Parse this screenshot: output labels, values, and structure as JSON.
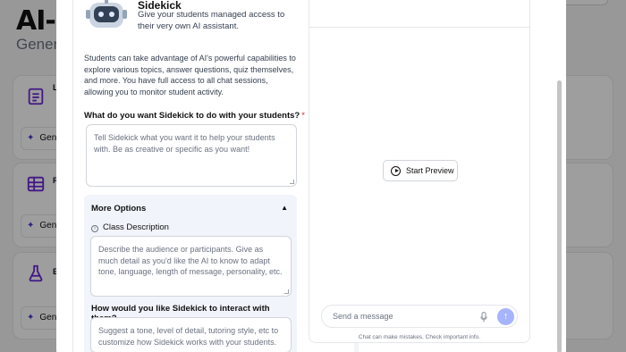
{
  "background": {
    "title": "AI-I",
    "subtitle": "Genera",
    "cards": [
      {
        "icon": "document-icon",
        "label": "L",
        "button": "Gene"
      },
      {
        "icon": "table-icon",
        "label": "R",
        "button": "Gene"
      },
      {
        "icon": "flask-icon",
        "label": "E",
        "button": "Gene"
      }
    ]
  },
  "sidekick": {
    "name": "Sidekick",
    "tagline": "Give your students managed access to their very own AI assistant.",
    "intro": "Students can take advantage of AI's powerful capabilities to explore various topics, answer questions, quiz themselves, and more. You have full access to all chat sessions, allowing you to monitor student activity.",
    "question_label": "What do you want Sidekick to do with your students?",
    "required_marker": "*",
    "question_placeholder": "Tell Sidekick what you want it to help your students with. Be as creative or specific as you want!",
    "more_options": {
      "title": "More Options",
      "class_description_label": "Class Description",
      "class_description_placeholder": "Describe the audience or participants. Give as much detail as you'd like the AI to know to adapt tone, language, length of message, personality, etc.",
      "interaction_label": "How would you like Sidekick to interact with them?",
      "interaction_placeholder": "Suggest a tone, level of detail, tutoring style, etc to customize how Sidekick works with your students."
    }
  },
  "preview": {
    "start_label": "Start Preview",
    "message_placeholder": "Send a message",
    "disclaimer": "Chat can make mistakes. Check important info."
  },
  "colors": {
    "accent": "#6d28d9",
    "send_button": "#a5b4fc",
    "required": "#dc2626",
    "options_bg": "#f1f4fb"
  }
}
